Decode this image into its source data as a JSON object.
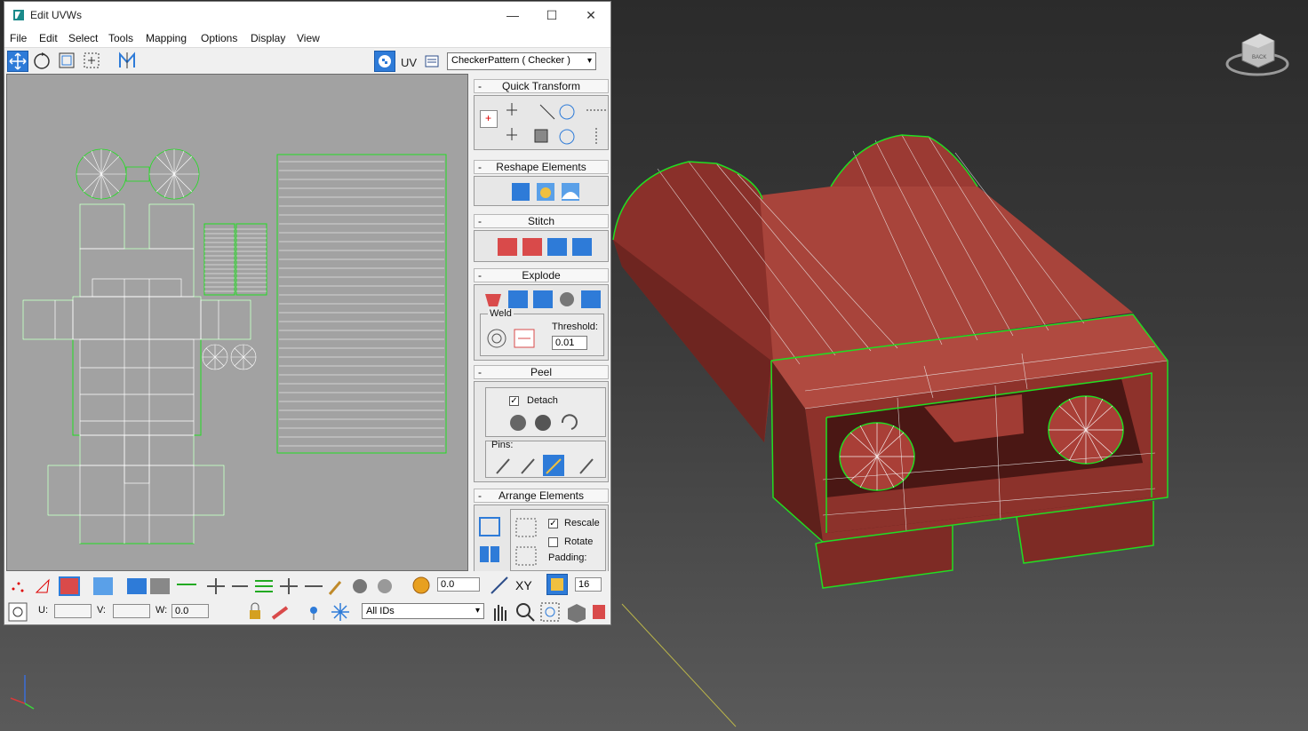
{
  "window": {
    "title": "Edit UVWs",
    "minimize": "—",
    "maximize": "☐",
    "close": "✕"
  },
  "menu": [
    "File",
    "Edit",
    "Select",
    "Tools",
    "Mapping",
    "Options",
    "Display",
    "View"
  ],
  "toolbar": {
    "uv_label": "UV",
    "map_select": "CheckerPattern  ( Checker )"
  },
  "rollouts": {
    "quick_transform": "Quick Transform",
    "reshape_elements": "Reshape Elements",
    "stitch": "Stitch",
    "explode": "Explode",
    "weld_label": "Weld",
    "threshold_label": "Threshold:",
    "threshold_value": "0.01",
    "peel": "Peel",
    "detach_label": "Detach",
    "detach_checked": true,
    "pins_label": "Pins:",
    "arrange_elements": "Arrange Elements",
    "rescale_label": "Rescale",
    "rescale_checked": true,
    "rotate_label": "Rotate",
    "rotate_checked": false,
    "padding_label": "Padding:",
    "minus": "-"
  },
  "bottom": {
    "soft_value": "0.0",
    "xy_label": "XY",
    "grid_value": "16",
    "u_label": "U:",
    "v_label": "V:",
    "w_label": "W:",
    "w_value": "0.0",
    "ids_select": "All IDs"
  },
  "viewcube_label": "BACK",
  "colors": {
    "accent": "#2e7bd8",
    "model_red": "#a33a32",
    "selection_green": "#22dd22",
    "uv_canvas": "#a2a2a2"
  }
}
